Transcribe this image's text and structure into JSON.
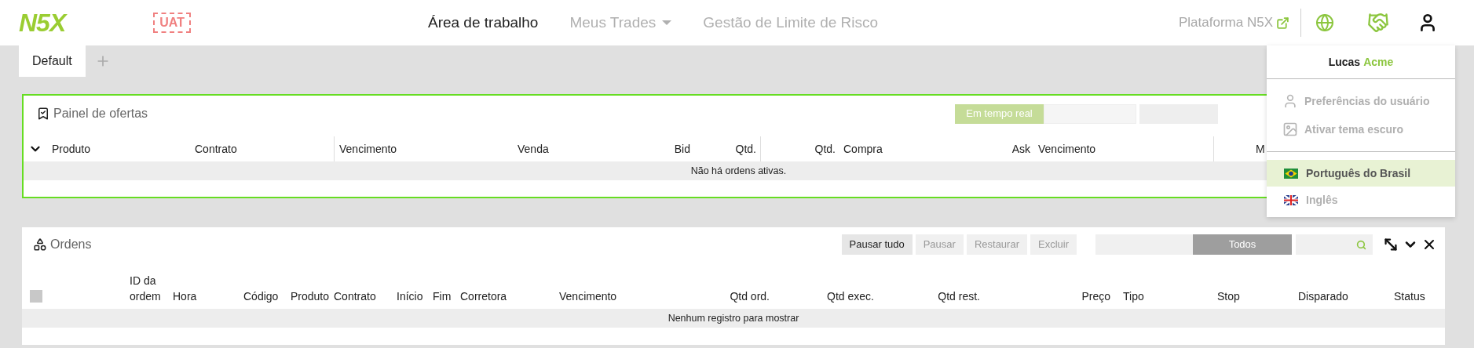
{
  "header": {
    "logo": "N5X",
    "env_badge": "UAT",
    "nav": [
      {
        "label": "Área de trabalho",
        "selected": true,
        "dropdown": false
      },
      {
        "label": "Meus Trades",
        "selected": false,
        "dropdown": true
      },
      {
        "label": "Gestão de Limite de Risco",
        "selected": false,
        "dropdown": false
      }
    ],
    "platform_link": "Plataforma N5X"
  },
  "tabs": [
    {
      "label": "Default",
      "selected": true
    }
  ],
  "offers_panel": {
    "title": "Painel de ofertas",
    "mode": {
      "label": "Em tempo real",
      "selected": true
    },
    "columns": [
      "Produto",
      "Contrato",
      "Vencimento",
      "Venda",
      "Bid",
      "Qtd.",
      "Qtd.",
      "Compra",
      "Ask",
      "Vencimento",
      "M"
    ],
    "empty_message": "Não há ordens ativas."
  },
  "orders_panel": {
    "title": "Ordens",
    "buttons": [
      {
        "label": "Pausar tudo",
        "disabled": false
      },
      {
        "label": "Pausar",
        "disabled": true
      },
      {
        "label": "Restaurar",
        "disabled": true
      },
      {
        "label": "Excluir",
        "disabled": true
      }
    ],
    "filter": {
      "label": "Todos",
      "selected": true
    },
    "select_all": {
      "disabled": true
    },
    "columns": [
      "ID da ordem",
      "Hora",
      "Código",
      "Produto",
      "Contrato",
      "Início",
      "Fim",
      "Corretora",
      "Vencimento",
      "Qtd ord.",
      "Qtd exec.",
      "Qtd rest.",
      "Preço",
      "Tipo",
      "Stop",
      "Disparado",
      "Status"
    ],
    "empty_message": "Nenhum registro para mostrar"
  },
  "user_menu": {
    "first_name": "Lucas",
    "last_name": "Acme",
    "items": [
      {
        "label": "Preferências do usuário",
        "kind": "profile"
      },
      {
        "label": "Ativar tema escuro",
        "kind": "theme"
      }
    ],
    "languages": [
      {
        "label": "Português do Brasil",
        "kind": "br",
        "selected": true
      },
      {
        "label": "Inglês",
        "kind": "gb",
        "selected": false
      }
    ]
  }
}
